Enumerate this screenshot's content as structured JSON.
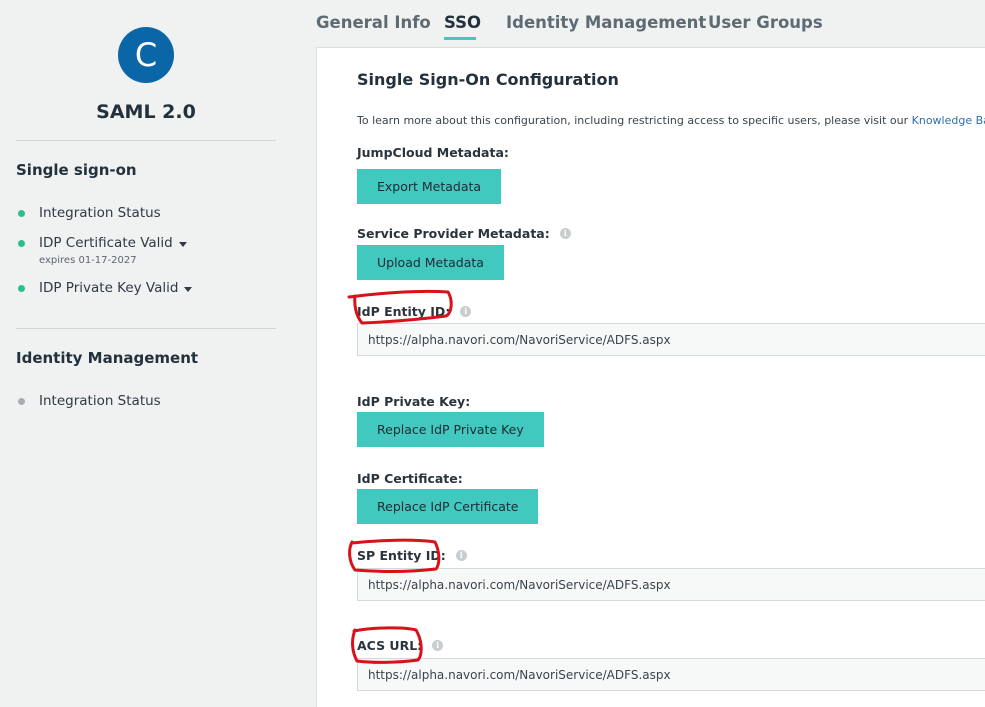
{
  "sidebar": {
    "avatar_letter": "C",
    "app_name": "SAML 2.0",
    "sso_heading": "Single sign-on",
    "sso_items": [
      {
        "label": "Integration Status",
        "status_color": "#2dbe8a"
      },
      {
        "label": "IDP Certificate Valid",
        "status_color": "#2dbe8a",
        "note": "expires 01-17-2027"
      },
      {
        "label": "IDP Private Key Valid",
        "status_color": "#2dbe8a"
      }
    ],
    "idm_heading": "Identity Management",
    "idm_items": [
      {
        "label": "Integration Status",
        "status_color": "#a9aeb2"
      }
    ]
  },
  "tabs": [
    {
      "label": "General Info",
      "active": false
    },
    {
      "label": "SSO",
      "active": true
    },
    {
      "label": "Identity Management",
      "active": false
    },
    {
      "label": "User Groups",
      "active": false
    }
  ],
  "main": {
    "title": "Single Sign-On Configuration",
    "info_text": "To learn more about this configuration, including restricting access to specific users, please visit our",
    "info_link": "Knowledge Base",
    "jumpcloud_metadata_label": "JumpCloud Metadata:",
    "export_metadata_button": "Export Metadata",
    "sp_metadata_label": "Service Provider Metadata:",
    "upload_metadata_button": "Upload Metadata",
    "idp_entity_id_label": "IdP Entity ID:",
    "idp_entity_id_value": "https://alpha.navori.com/NavoriService/ADFS.aspx",
    "idp_private_key_label": "IdP Private Key:",
    "replace_private_key_button": "Replace IdP Private Key",
    "idp_certificate_label": "IdP Certificate:",
    "replace_certificate_button": "Replace IdP Certificate",
    "sp_entity_id_label": "SP Entity ID:",
    "sp_entity_id_value": "https://alpha.navori.com/NavoriService/ADFS.aspx",
    "acs_url_label": "ACS URL:",
    "acs_url_value": "https://alpha.navori.com/NavoriService/ADFS.aspx",
    "info_icon_glyph": "i"
  },
  "colors": {
    "accent": "#41c8bf",
    "avatar": "#0a66a7",
    "link": "#2f6fa8",
    "annotation": "#d8111a"
  }
}
